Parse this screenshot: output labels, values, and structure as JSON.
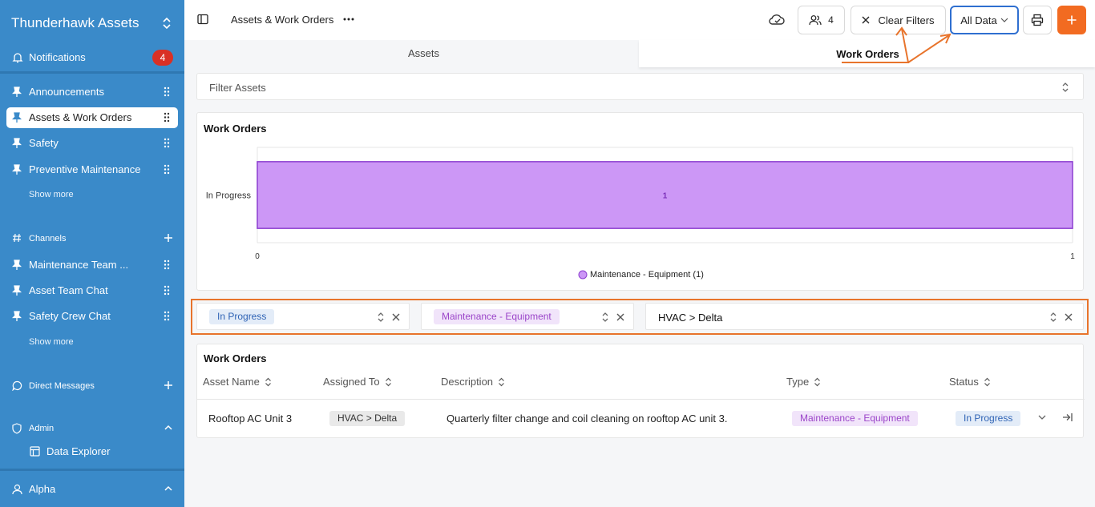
{
  "sidebar": {
    "workspace": "Thunderhawk Assets",
    "notifications": {
      "label": "Notifications",
      "count": "4"
    },
    "pinned": [
      {
        "label": "Announcements"
      },
      {
        "label": "Assets & Work Orders"
      },
      {
        "label": "Safety"
      },
      {
        "label": "Preventive Maintenance"
      }
    ],
    "show_more_1": "Show more",
    "channels_label": "Channels",
    "channels": [
      {
        "label": "Maintenance Team ..."
      },
      {
        "label": "Asset Team Chat"
      },
      {
        "label": "Safety Crew Chat"
      }
    ],
    "show_more_2": "Show more",
    "direct_messages": "Direct Messages",
    "admin": "Admin",
    "data_explorer": "Data Explorer",
    "user": "Alpha"
  },
  "header": {
    "breadcrumb": "Assets & Work Orders",
    "members_count": "4",
    "clear_filters": "Clear Filters",
    "data_scope": "All Data"
  },
  "tabs": {
    "assets": "Assets",
    "work_orders": "Work Orders"
  },
  "filter_assets": {
    "placeholder": "Filter Assets"
  },
  "chart_card": {
    "title": "Work Orders"
  },
  "chart_data": {
    "type": "bar",
    "orientation": "horizontal",
    "categories": [
      "In Progress"
    ],
    "series": [
      {
        "name": "Maintenance - Equipment",
        "values": [
          1
        ]
      }
    ],
    "data_labels": [
      "1"
    ],
    "xlim": [
      0,
      1
    ],
    "x_ticks": [
      "0",
      "1"
    ],
    "legend": "Maintenance - Equipment (1)",
    "legend_position": "bottom",
    "bar_color": "#cc97f6",
    "bar_border": "#8c3fd0"
  },
  "filters": {
    "status": "In Progress",
    "type": "Maintenance - Equipment",
    "assigned": "HVAC > Delta"
  },
  "table": {
    "title": "Work Orders",
    "columns": [
      "Asset Name",
      "Assigned To",
      "Description",
      "Type",
      "Status"
    ],
    "rows": [
      {
        "asset": "Rooftop AC Unit 3",
        "assigned": "HVAC > Delta",
        "description": "Quarterly filter change and coil cleaning on rooftop AC unit 3.",
        "type": "Maintenance - Equipment",
        "status": "In Progress"
      }
    ]
  },
  "colors": {
    "sidebar": "#3a8ac9",
    "accent": "#f26b21",
    "annotation": "#e8742c"
  }
}
